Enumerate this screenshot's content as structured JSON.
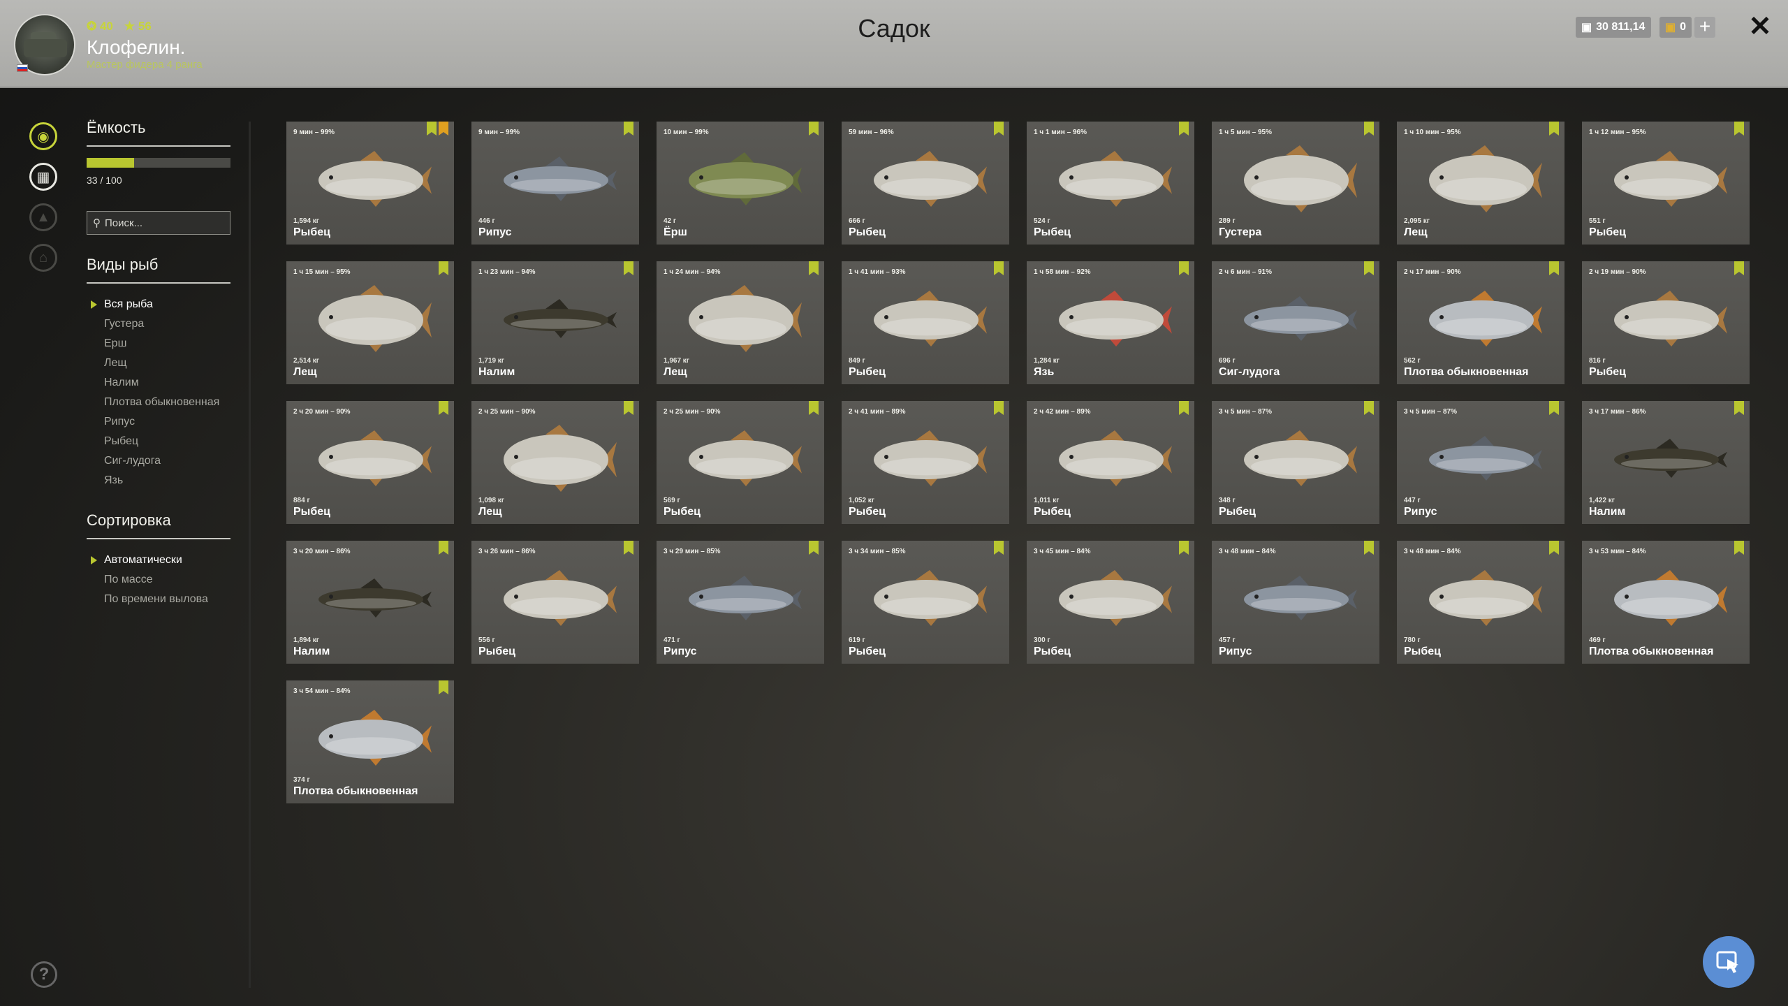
{
  "header": {
    "title": "Садок",
    "username": "Клофелин.",
    "rank": "Мастер фидера 4 ранга",
    "level": "40",
    "stars": "56",
    "money": "30 811,14",
    "gold": "0",
    "plus_label": "+",
    "close_label": "✕"
  },
  "sidebar": {
    "capacity_title": "Ёмкость",
    "capacity_text": "33 / 100",
    "capacity_fraction": 0.33,
    "search_placeholder": "Поиск...",
    "species_title": "Виды рыб",
    "species": [
      "Вся рыба",
      "Густера",
      "Ерш",
      "Лещ",
      "Налим",
      "Плотва обыкновенная",
      "Рипус",
      "Рыбец",
      "Сиг-лудога",
      "Язь"
    ],
    "species_selected": 0,
    "sort_title": "Сортировка",
    "sort": [
      "Автоматически",
      "По массе",
      "По времени вылова"
    ],
    "sort_selected": 0
  },
  "help_label": "?",
  "colors": {
    "accent": "#b9c630",
    "orange_mark": "#e0a020",
    "card": "#55544f"
  },
  "fish": [
    {
      "time": "9 мин – 99%",
      "weight": "1,594 кг",
      "name": "Рыбец",
      "marks": 2
    },
    {
      "time": "9 мин – 99%",
      "weight": "446 г",
      "name": "Рипус",
      "marks": 1
    },
    {
      "time": "10 мин – 99%",
      "weight": "42 г",
      "name": "Ёрш",
      "marks": 1
    },
    {
      "time": "59 мин – 96%",
      "weight": "666 г",
      "name": "Рыбец",
      "marks": 1
    },
    {
      "time": "1 ч 1 мин – 96%",
      "weight": "524 г",
      "name": "Рыбец",
      "marks": 1
    },
    {
      "time": "1 ч 5 мин – 95%",
      "weight": "289 г",
      "name": "Густера",
      "marks": 1
    },
    {
      "time": "1 ч 10 мин – 95%",
      "weight": "2,095 кг",
      "name": "Лещ",
      "marks": 1
    },
    {
      "time": "1 ч 12 мин – 95%",
      "weight": "551 г",
      "name": "Рыбец",
      "marks": 1
    },
    {
      "time": "1 ч 15 мин – 95%",
      "weight": "2,514 кг",
      "name": "Лещ",
      "marks": 1
    },
    {
      "time": "1 ч 23 мин – 94%",
      "weight": "1,719 кг",
      "name": "Налим",
      "marks": 1
    },
    {
      "time": "1 ч 24 мин – 94%",
      "weight": "1,967 кг",
      "name": "Лещ",
      "marks": 1
    },
    {
      "time": "1 ч 41 мин – 93%",
      "weight": "849 г",
      "name": "Рыбец",
      "marks": 1
    },
    {
      "time": "1 ч 58 мин – 92%",
      "weight": "1,284 кг",
      "name": "Язь",
      "marks": 1
    },
    {
      "time": "2 ч 6 мин – 91%",
      "weight": "696 г",
      "name": "Сиг-лудога",
      "marks": 1
    },
    {
      "time": "2 ч 17 мин – 90%",
      "weight": "562 г",
      "name": "Плотва обыкновенная",
      "marks": 1
    },
    {
      "time": "2 ч 19 мин – 90%",
      "weight": "816 г",
      "name": "Рыбец",
      "marks": 1
    },
    {
      "time": "2 ч 20 мин – 90%",
      "weight": "884 г",
      "name": "Рыбец",
      "marks": 1
    },
    {
      "time": "2 ч 25 мин – 90%",
      "weight": "1,098 кг",
      "name": "Лещ",
      "marks": 1
    },
    {
      "time": "2 ч 25 мин – 90%",
      "weight": "569 г",
      "name": "Рыбец",
      "marks": 1
    },
    {
      "time": "2 ч 41 мин – 89%",
      "weight": "1,052 кг",
      "name": "Рыбец",
      "marks": 1
    },
    {
      "time": "2 ч 42 мин – 89%",
      "weight": "1,011 кг",
      "name": "Рыбец",
      "marks": 1
    },
    {
      "time": "3 ч 5 мин – 87%",
      "weight": "348 г",
      "name": "Рыбец",
      "marks": 1
    },
    {
      "time": "3 ч 5 мин – 87%",
      "weight": "447 г",
      "name": "Рипус",
      "marks": 1
    },
    {
      "time": "3 ч 17 мин – 86%",
      "weight": "1,422 кг",
      "name": "Налим",
      "marks": 1
    },
    {
      "time": "3 ч 20 мин – 86%",
      "weight": "1,894 кг",
      "name": "Налим",
      "marks": 1
    },
    {
      "time": "3 ч 26 мин – 86%",
      "weight": "556 г",
      "name": "Рыбец",
      "marks": 1
    },
    {
      "time": "3 ч 29 мин – 85%",
      "weight": "471 г",
      "name": "Рипус",
      "marks": 1
    },
    {
      "time": "3 ч 34 мин – 85%",
      "weight": "619 г",
      "name": "Рыбец",
      "marks": 1
    },
    {
      "time": "3 ч 45 мин – 84%",
      "weight": "300 г",
      "name": "Рыбец",
      "marks": 1
    },
    {
      "time": "3 ч 48 мин – 84%",
      "weight": "457 г",
      "name": "Рипус",
      "marks": 1
    },
    {
      "time": "3 ч 48 мин – 84%",
      "weight": "780 г",
      "name": "Рыбец",
      "marks": 1
    },
    {
      "time": "3 ч 53 мин – 84%",
      "weight": "469 г",
      "name": "Плотва обыкновенная",
      "marks": 1
    },
    {
      "time": "3 ч 54 мин – 84%",
      "weight": "374 г",
      "name": "Плотва обыкновенная",
      "marks": 1
    }
  ]
}
